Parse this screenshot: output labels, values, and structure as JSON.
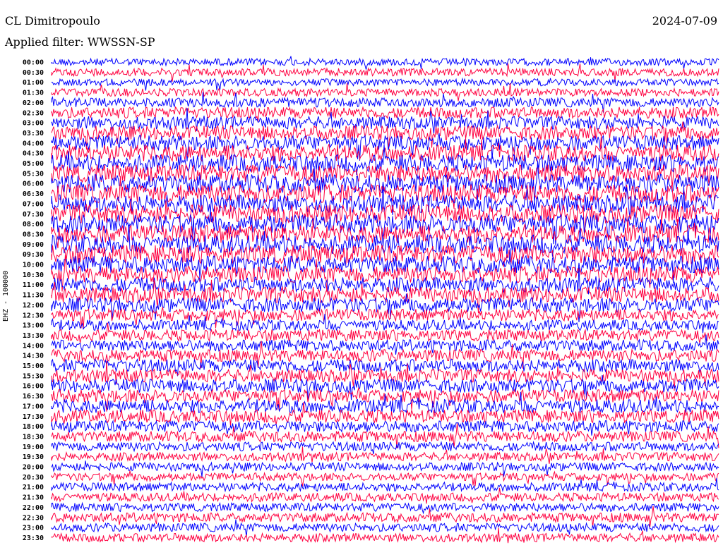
{
  "chart_data": {
    "type": "line",
    "title": "CL Dimitropoulo",
    "subtitle": "Applied filter: WWSSN-SP",
    "date": "2024-07-09",
    "ylabel": "EHZ - 100000",
    "row_labels": [
      "00:00",
      "00:30",
      "01:00",
      "01:30",
      "02:00",
      "02:30",
      "03:00",
      "03:30",
      "04:00",
      "04:30",
      "05:00",
      "05:30",
      "06:00",
      "06:30",
      "07:00",
      "07:30",
      "08:00",
      "08:30",
      "09:00",
      "09:30",
      "10:00",
      "10:30",
      "11:00",
      "11:30",
      "12:00",
      "12:30",
      "13:00",
      "13:30",
      "14:00",
      "14:30",
      "15:00",
      "15:30",
      "16:00",
      "16:30",
      "17:00",
      "17:30",
      "18:00",
      "18:30",
      "19:00",
      "19:30",
      "20:00",
      "20:30",
      "21:00",
      "21:30",
      "22:00",
      "22:30",
      "23:00",
      "23:30"
    ],
    "series_colors": [
      "#0000ff",
      "#ff0040"
    ],
    "highlight_color": "#ffffff",
    "row_intensity": [
      0.2,
      0.25,
      0.2,
      0.25,
      0.35,
      0.5,
      0.6,
      0.7,
      0.75,
      0.85,
      0.9,
      0.95,
      1.0,
      1.0,
      0.95,
      1.0,
      1.0,
      0.95,
      1.0,
      1.0,
      0.9,
      0.85,
      0.75,
      0.8,
      0.7,
      0.55,
      0.45,
      0.5,
      0.5,
      0.55,
      0.6,
      0.6,
      0.65,
      0.6,
      0.65,
      0.6,
      0.5,
      0.45,
      0.35,
      0.3,
      0.3,
      0.25,
      0.3,
      0.3,
      0.3,
      0.35,
      0.3,
      0.3
    ]
  }
}
